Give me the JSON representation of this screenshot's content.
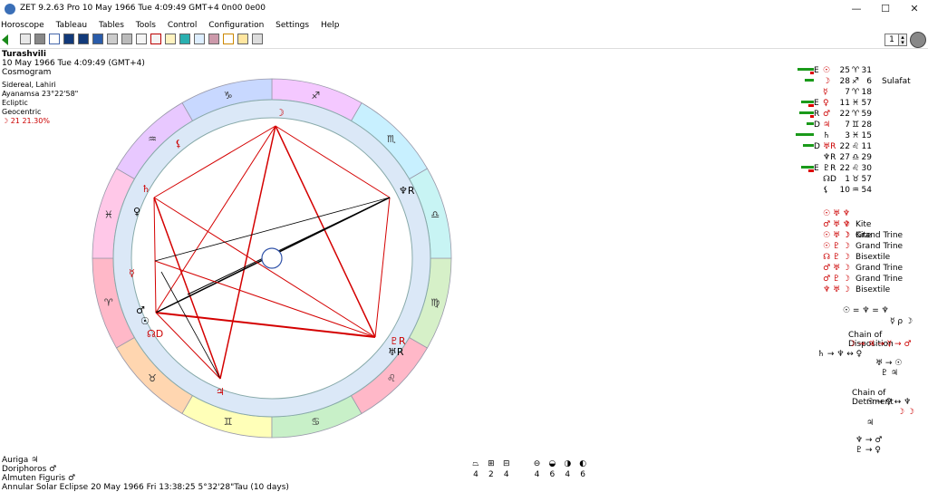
{
  "window": {
    "title": "ZET 9.2.63 Pro   10 May 1966  Tue   4:09:49 GMT+4 0n00  0e00",
    "minimize": "—",
    "maximize": "☐",
    "close": "✕"
  },
  "menu": [
    "Horoscope",
    "Tableau",
    "Tables",
    "Tools",
    "Control",
    "Configuration",
    "Settings",
    "Help"
  ],
  "toolbar": {
    "page_number": "1"
  },
  "info": {
    "name": "Turashvili",
    "datetime": "10 May 1966  Tue   4:09:49 (GMT+4)",
    "type": "Cosmogram",
    "zodiac": "Sidereal, Lahiri",
    "ayanamsa": "Ayanamsa 23°22'58\"",
    "plane": "Ecliptic",
    "center": "Geocentric",
    "moon_phase": "☽  21 21.30%"
  },
  "bottom": {
    "auriga": "Auriga  ♃",
    "doriphoros": "Doriphoros  ♂",
    "almuten": "Almuten Figuris  ♂",
    "eclipse": "Annular Solar Eclipse 20 May 1966 Fri 13:38:25  5°32'28\"Tau (10 days)"
  },
  "element_counts": [
    "4",
    "2",
    "4",
    "4",
    "6",
    "4",
    "6"
  ],
  "planets": [
    {
      "mark": "E",
      "glyph": "☉",
      "deg": "25",
      "sign": "♈",
      "min": "31",
      "extra": ""
    },
    {
      "mark": "",
      "glyph": "☽",
      "deg": "28",
      "sign": "♐",
      "min": "6",
      "extra": "Sulafat"
    },
    {
      "mark": "",
      "glyph": "☿",
      "deg": "7",
      "sign": "♈",
      "min": "18",
      "extra": ""
    },
    {
      "mark": "E",
      "glyph": "♀",
      "deg": "11",
      "sign": "♓",
      "min": "57",
      "extra": ""
    },
    {
      "mark": "R",
      "glyph": "♂",
      "deg": "22",
      "sign": "♈",
      "min": "59",
      "extra": ""
    },
    {
      "mark": "D",
      "glyph": "♃",
      "deg": "7",
      "sign": "♊",
      "min": "28",
      "extra": ""
    },
    {
      "mark": "",
      "glyph": "♄",
      "deg": "3",
      "sign": "♓",
      "min": "15",
      "extra": ""
    },
    {
      "mark": "D",
      "glyph": "♅R",
      "deg": "22",
      "sign": "♌",
      "min": "11",
      "extra": ""
    },
    {
      "mark": "",
      "glyph": "♆R",
      "deg": "27",
      "sign": "♎",
      "min": "29",
      "extra": ""
    },
    {
      "mark": "E",
      "glyph": "♇R",
      "deg": "22",
      "sign": "♌",
      "min": "30",
      "extra": ""
    },
    {
      "mark": "",
      "glyph": "☊D",
      "deg": "1",
      "sign": "♉",
      "min": "57",
      "extra": ""
    },
    {
      "mark": "",
      "glyph": "⚸",
      "deg": "10",
      "sign": "♒",
      "min": "54",
      "extra": ""
    }
  ],
  "patterns": [
    {
      "glyphs": "☉ ♅ ♆ ☽",
      "name": "Kite"
    },
    {
      "glyphs": "♂ ♅ ♆ ☽",
      "name": "Kite"
    },
    {
      "glyphs": "☉ ♅ ☽",
      "name": "Grand Trine"
    },
    {
      "glyphs": "☉ ♇ ☽",
      "name": "Grand Trine"
    },
    {
      "glyphs": "☊ ♇ ☽",
      "name": "Bisextile"
    },
    {
      "glyphs": "♂ ♅ ☽",
      "name": "Grand Trine"
    },
    {
      "glyphs": "♂ ♇ ☽",
      "name": "Grand Trine"
    },
    {
      "glyphs": "♆ ♅ ☽",
      "name": "Bisextile"
    }
  ],
  "chains": {
    "disposition_title": "Chain of Disposition",
    "detriment_title": "Chain of Detriment",
    "disp_top1": "☉ = ♆ = ♆",
    "disp_top2": "☿ ρ ☽",
    "disp_row1": "☽ → ♃ → ☿ → ♂",
    "disp_row2": "♄ → ♆ ↔ ♀",
    "disp_row3": "♅ → ☉",
    "disp_row4": "♇ ♃",
    "det_row1": "☉ → ♀ ↔ ♆",
    "det_row2": "☽ ☽",
    "det_row3": "♃",
    "det_row4": "♆ → ♂",
    "det_row5": "♇ → ♀"
  },
  "wheel_signs": [
    "♈",
    "♉",
    "♊",
    "♋",
    "♌",
    "♍",
    "♎",
    "♏",
    "♐",
    "♑",
    "♒",
    "♓"
  ],
  "colors": {
    "fire": "#ffb3c6",
    "earth": "#ffd9b0",
    "air": "#ffffb0",
    "water": "#c8f0c8",
    "inner": "#dbe8f7",
    "aspect_red": "#d40000"
  }
}
